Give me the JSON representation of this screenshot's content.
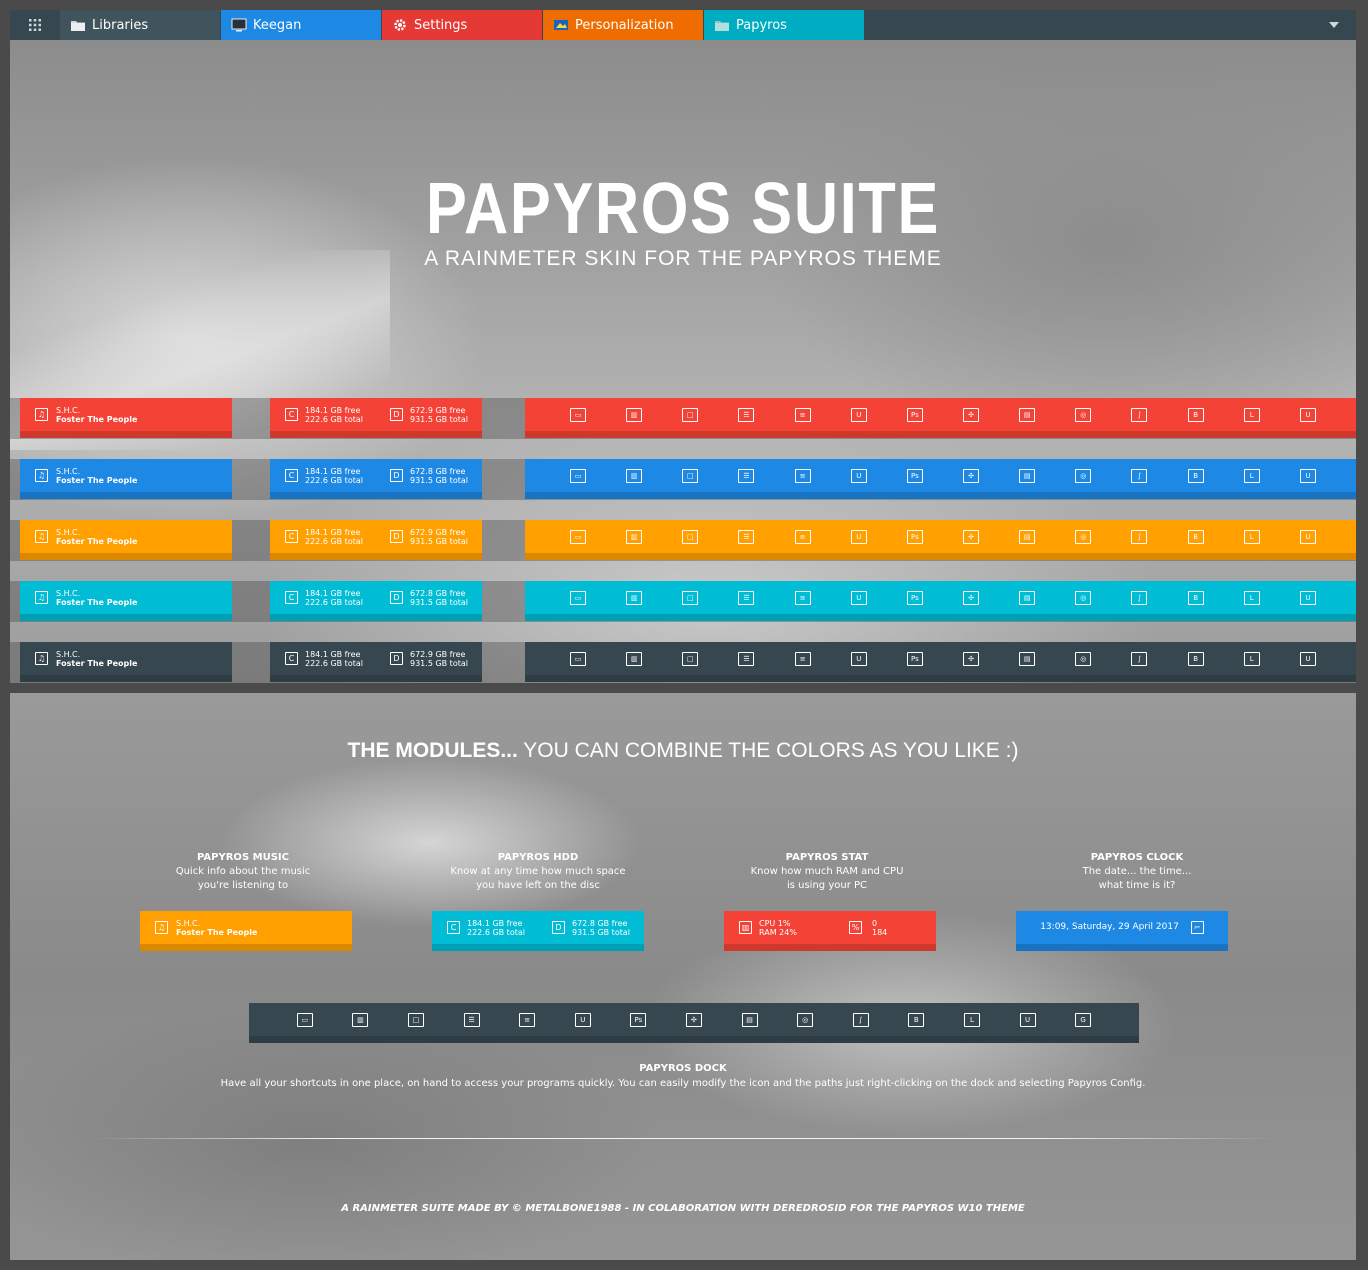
{
  "tabbar": {
    "tabs": [
      {
        "label": "Libraries",
        "color": "#3f545d",
        "icon": "folder-icon"
      },
      {
        "label": "Keegan",
        "color": "#1e88e5",
        "icon": "monitor-icon"
      },
      {
        "label": "Settings",
        "color": "#e53935",
        "icon": "gear-icon"
      },
      {
        "label": "Personalization",
        "color": "#ef6c00",
        "icon": "personalization-icon"
      },
      {
        "label": "Papyros",
        "color": "#00acc1",
        "icon": "folder-icon"
      }
    ]
  },
  "hero": {
    "title": "PAPYROS SUITE",
    "subtitle": "A RAINMETER SKIN FOR THE PAPYROS THEME"
  },
  "color_rows": [
    {
      "color": "#f44336",
      "hdd_c_free": "184.1 GB free",
      "hdd_c_total": "222.6 GB total",
      "hdd_d_free": "672.9 GB free",
      "hdd_d_total": "931.5 GB total"
    },
    {
      "color": "#1e88e5",
      "hdd_c_free": "184.1 GB free",
      "hdd_c_total": "222.6 GB total",
      "hdd_d_free": "672.8 GB free",
      "hdd_d_total": "931.5 GB total"
    },
    {
      "color": "#ffa000",
      "hdd_c_free": "184.1 GB free",
      "hdd_c_total": "222.6 GB total",
      "hdd_d_free": "672.9 GB free",
      "hdd_d_total": "931.5 GB total"
    },
    {
      "color": "#00bcd4",
      "hdd_c_free": "184.1 GB free",
      "hdd_c_total": "222.6 GB total",
      "hdd_d_free": "672.8 GB free",
      "hdd_d_total": "931.5 GB total"
    },
    {
      "color": "#37474f",
      "hdd_c_free": "184.1 GB free",
      "hdd_c_total": "222.6 GB total",
      "hdd_d_free": "672.9 GB free",
      "hdd_d_total": "931.5 GB total"
    }
  ],
  "music": {
    "line1": "S.H.C.",
    "line2": "Foster The People"
  },
  "drive_letters": {
    "c": "C",
    "d": "D"
  },
  "dock_icons": [
    "monitor-icon",
    "archive-icon",
    "stop-icon",
    "chat-icon",
    "list-icon",
    "u-icon",
    "ps-icon",
    "target-icon",
    "window-icon",
    "camera-icon",
    "link-icon",
    "b-icon",
    "l-icon",
    "cup-icon",
    "g-icon"
  ],
  "dock_glyphs": [
    "▭",
    "▥",
    "□",
    "☰",
    "≡",
    "U",
    "Ps",
    "✣",
    "▤",
    "◎",
    "∫",
    "B",
    "L",
    "U",
    "G"
  ],
  "modules": {
    "heading_bold": "THE MODULES...",
    "heading_rest": " YOU CAN COMBINE THE COLORS AS YOU LIKE :)",
    "music": {
      "title": "PAPYROS MUSIC",
      "line1": "Quick info about the music",
      "line2": "you're listening to",
      "color": "#ffa000"
    },
    "hdd": {
      "title": "PAPYROS HDD",
      "line1": "Know at any time how much space",
      "line2": "you have left on the disc",
      "color": "#00bcd4",
      "c_free": "184.1 GB free",
      "c_total": "222.6 GB total",
      "d_free": "672.8 GB free",
      "d_total": "931.5 GB total"
    },
    "stat": {
      "title": "PAPYROS STAT",
      "line1": "Know how much RAM and CPU",
      "line2": "is using your PC",
      "color": "#f44336",
      "cpu": "CPU 1%",
      "ram": "RAM 24%",
      "v1": "0",
      "v2": "184"
    },
    "clock": {
      "title": "PAPYROS CLOCK",
      "line1": "The date... the time...",
      "line2": "what time is it?",
      "color": "#1e88e5",
      "datetime": "13:09, Saturday, 29 April 2017"
    },
    "dock": {
      "title": "PAPYROS DOCK",
      "text": "Have all your shortcuts in one place, on hand to access your programs quickly. You can easily modify the icon and the paths just right-clicking on the dock and selecting Papyros Config.",
      "color": "#37474f"
    }
  },
  "credits": "A RAINMETER SUITE MADE BY © METALBONE1988 - IN COLABORATION WITH DEREDROSID FOR THE PAPYROS W10 THEME"
}
